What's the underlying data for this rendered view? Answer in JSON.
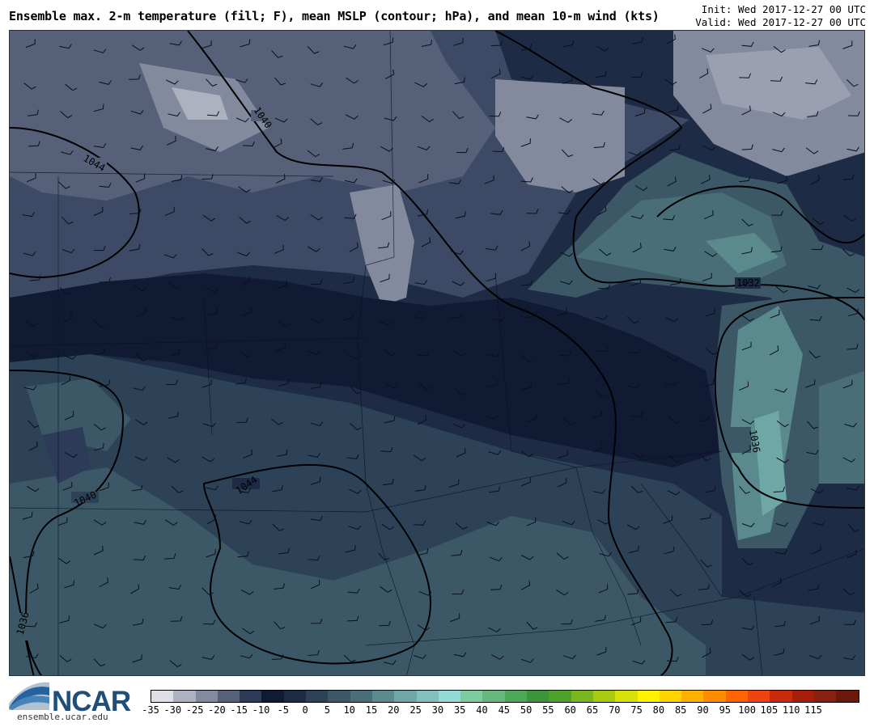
{
  "header": {
    "title": "Ensemble max. 2-m temperature (fill; F), mean MSLP (contour; hPa), and mean 10-m wind (kts)",
    "init": "Init: Wed 2017-12-27 00 UTC",
    "valid": "Valid: Wed 2017-12-27 00 UTC"
  },
  "map": {
    "contour_labels": [
      "1040",
      "1044",
      "1032",
      "1036",
      "1044",
      "1040",
      "1036"
    ]
  },
  "colorbar": {
    "ticks": [
      "-35",
      "-30",
      "-25",
      "-20",
      "-15",
      "-10",
      "-5",
      "0",
      "5",
      "10",
      "15",
      "20",
      "25",
      "30",
      "35",
      "40",
      "45",
      "50",
      "55",
      "60",
      "65",
      "70",
      "75",
      "80",
      "85",
      "90",
      "95",
      "100",
      "105",
      "110",
      "115"
    ],
    "colors": [
      "#dfe0e6",
      "#aeb1bf",
      "#838a9d",
      "#566078",
      "#2d3a58",
      "#111a33",
      "#1e2b45",
      "#2d4257",
      "#3c5867",
      "#4a6e77",
      "#5b8a8e",
      "#6fa6a6",
      "#82bfbd",
      "#93dcd6",
      "#7ccc9f",
      "#65b97d",
      "#4ea85a",
      "#3b963b",
      "#4ea12a",
      "#7ab61f",
      "#a8cb10",
      "#d8e10a",
      "#fff200",
      "#ffd400",
      "#ffb000",
      "#ff8c00",
      "#ff6400",
      "#ef4410",
      "#c92a0c",
      "#a61d0a",
      "#862010",
      "#6b180c"
    ]
  },
  "branding": {
    "logo_text": "NCAR",
    "url": "ensemble.ucar.edu"
  }
}
